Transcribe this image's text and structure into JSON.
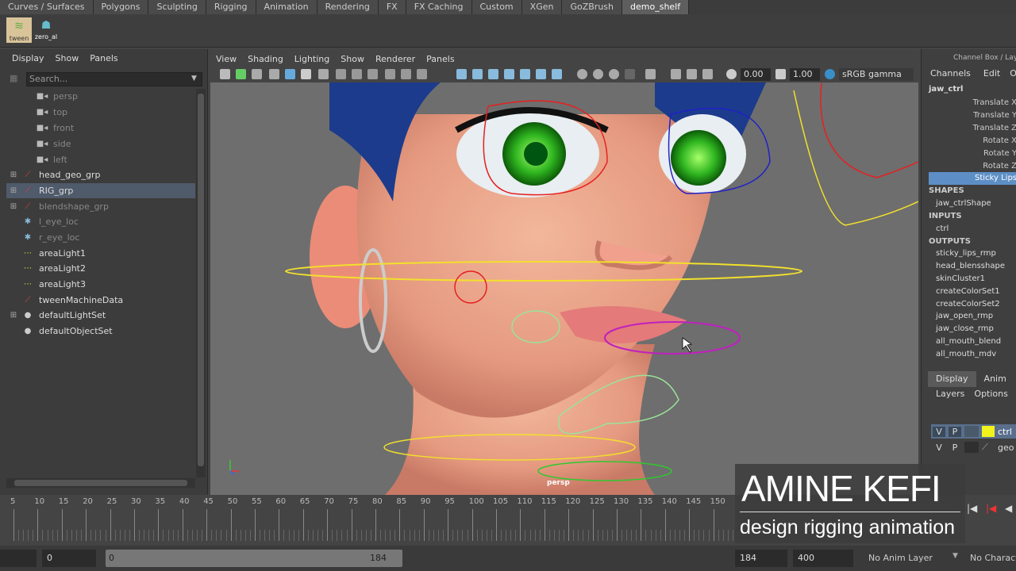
{
  "shelf_tabs": [
    "Curves / Surfaces",
    "Polygons",
    "Sculpting",
    "Rigging",
    "Animation",
    "Rendering",
    "FX",
    "FX Caching",
    "Custom",
    "XGen",
    "GoZBrush",
    "demo_shelf"
  ],
  "shelf_buttons": {
    "tween": "tween",
    "zero": "zero_al"
  },
  "outliner": {
    "menu": [
      "Display",
      "Show",
      "Panels"
    ],
    "search_placeholder": "Search...",
    "items": [
      {
        "label": "persp"
      },
      {
        "label": "top"
      },
      {
        "label": "front"
      },
      {
        "label": "side"
      },
      {
        "label": "left"
      },
      {
        "label": "head_geo_grp"
      },
      {
        "label": "RIG_grp"
      },
      {
        "label": "blendshape_grp"
      },
      {
        "label": "l_eye_loc"
      },
      {
        "label": "r_eye_loc"
      },
      {
        "label": "areaLight1"
      },
      {
        "label": "areaLight2"
      },
      {
        "label": "areaLight3"
      },
      {
        "label": "tweenMachineData"
      },
      {
        "label": "defaultLightSet"
      },
      {
        "label": "defaultObjectSet"
      }
    ]
  },
  "viewport": {
    "menu": [
      "View",
      "Shading",
      "Lighting",
      "Show",
      "Renderer",
      "Panels"
    ],
    "exposure": "0.00",
    "gamma": "1.00",
    "colorspace": "sRGB gamma",
    "camera_label": "persp"
  },
  "channel_box": {
    "title": "Channel Box / Layer",
    "menu": [
      "Channels",
      "Edit",
      "O"
    ],
    "node": "jaw_ctrl",
    "attrs": [
      "Translate X",
      "Translate Y",
      "Translate Z",
      "Rotate X",
      "Rotate Y",
      "Rotate Z",
      "Sticky Lips"
    ],
    "shapes_header": "SHAPES",
    "shapes": [
      "jaw_ctrlShape"
    ],
    "inputs_header": "INPUTS",
    "inputs": [
      "ctrl"
    ],
    "outputs_header": "OUTPUTS",
    "outputs": [
      "sticky_lips_rmp",
      "head_blensshape",
      "skinCluster1",
      "createColorSet1",
      "createColorSet2",
      "jaw_open_rmp",
      "jaw_close_rmp",
      "all_mouth_blend",
      "all_mouth_mdv"
    ],
    "layer_tabs": [
      "Display",
      "Anim"
    ],
    "layer_menu": [
      "Layers",
      "Options"
    ],
    "layers": [
      {
        "v": "V",
        "p": "P",
        "name": "ctrl",
        "color": "#f2f21c"
      },
      {
        "v": "V",
        "p": "P",
        "name": "geo",
        "color": ""
      }
    ]
  },
  "timeline": {
    "ticks": [
      "5",
      "10",
      "15",
      "20",
      "25",
      "30",
      "35",
      "40",
      "45",
      "50",
      "55",
      "60",
      "65",
      "70",
      "75",
      "80",
      "85",
      "90",
      "95",
      "100",
      "105",
      "110",
      "115",
      "120",
      "125",
      "130",
      "135",
      "140",
      "145",
      "150"
    ]
  },
  "range": {
    "start_field": "0",
    "range_start": "0",
    "range_end": "184",
    "end_field": "184",
    "max_field": "400",
    "anim_layer": "No Anim Layer",
    "character": "No Characte"
  },
  "brand": {
    "name": "AMINE KEFI",
    "tagline": "design rigging animation"
  },
  "colors": {
    "selected_row": "#4f5a6a",
    "sticky_lips_highlight": "#5d8fc6",
    "layer_yellow": "#f2f21c"
  }
}
